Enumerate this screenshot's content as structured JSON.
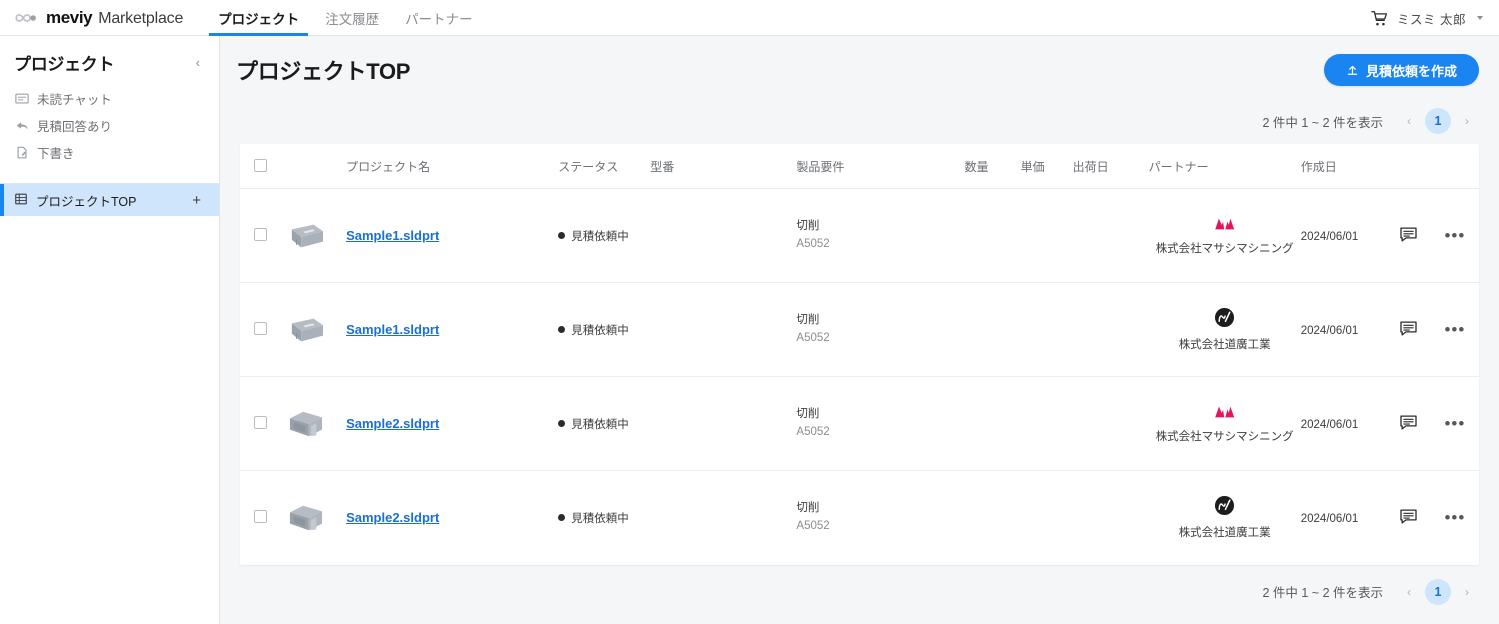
{
  "header": {
    "brand_meviy": "meviy",
    "brand_marketplace": "Marketplace",
    "tabs": [
      {
        "label": "プロジェクト",
        "active": true
      },
      {
        "label": "注文履歴",
        "active": false
      },
      {
        "label": "パートナー",
        "active": false
      }
    ],
    "cart_icon": "cart-icon",
    "user_name": "ミスミ 太郎",
    "accent_color": "#1a84f0"
  },
  "sidebar": {
    "title": "プロジェクト",
    "collapse_icon": "‹",
    "items": [
      {
        "label": "未読チャット",
        "icon": "chat-icon"
      },
      {
        "label": "見積回答あり",
        "icon": "reply-arrow-icon"
      },
      {
        "label": "下書き",
        "icon": "draft-file-icon"
      }
    ],
    "active_item": {
      "label": "プロジェクトTOP",
      "icon": "list-icon",
      "add_label": "+"
    }
  },
  "main": {
    "page_title": "プロジェクトTOP",
    "create_button": {
      "label": "見積依頼を作成",
      "icon": "upload-icon"
    },
    "pagination": {
      "summary": "2 件中 1 ~ 2 件を表示",
      "prev": "‹",
      "next": "›",
      "current_page": "1"
    },
    "table": {
      "headers": {
        "checkbox": "",
        "thumbnail": "",
        "name": "プロジェクト名",
        "status": "ステータス",
        "model": "型番",
        "requirement": "製品要件",
        "quantity": "数量",
        "unit_price": "単価",
        "ship_date": "出荷日",
        "partner": "パートナー",
        "created": "作成日",
        "chat": "",
        "more": ""
      },
      "rows": [
        {
          "name": "Sample1.sldprt",
          "thumb": "flat-plate-part-thumbnail",
          "status": "見積依頼中",
          "model": "",
          "req_process": "切削",
          "req_material": "A5052",
          "quantity": "",
          "unit_price": "",
          "ship_date": "",
          "partner_name": "株式会社マサシマシニング",
          "partner_logo": "masashi-machining-logo",
          "created": "2024/06/01",
          "chat_icon": "chat-icon",
          "more_icon": "more-options-icon"
        },
        {
          "name": "Sample1.sldprt",
          "thumb": "flat-plate-part-thumbnail",
          "status": "見積依頼中",
          "model": "",
          "req_process": "切削",
          "req_material": "A5052",
          "quantity": "",
          "unit_price": "",
          "ship_date": "",
          "partner_name": "株式会社道廣工業",
          "partner_logo": "michihiro-kogyo-logo",
          "created": "2024/06/01",
          "chat_icon": "chat-icon",
          "more_icon": "more-options-icon"
        },
        {
          "name": "Sample2.sldprt",
          "thumb": "bracket-part-thumbnail",
          "status": "見積依頼中",
          "model": "",
          "req_process": "切削",
          "req_material": "A5052",
          "quantity": "",
          "unit_price": "",
          "ship_date": "",
          "partner_name": "株式会社マサシマシニング",
          "partner_logo": "masashi-machining-logo",
          "created": "2024/06/01",
          "chat_icon": "chat-icon",
          "more_icon": "more-options-icon"
        },
        {
          "name": "Sample2.sldprt",
          "thumb": "bracket-part-thumbnail",
          "status": "見積依頼中",
          "model": "",
          "req_process": "切削",
          "req_material": "A5052",
          "quantity": "",
          "unit_price": "",
          "ship_date": "",
          "partner_name": "株式会社道廣工業",
          "partner_logo": "michihiro-kogyo-logo",
          "created": "2024/06/01",
          "chat_icon": "chat-icon",
          "more_icon": "more-options-icon"
        }
      ]
    }
  }
}
